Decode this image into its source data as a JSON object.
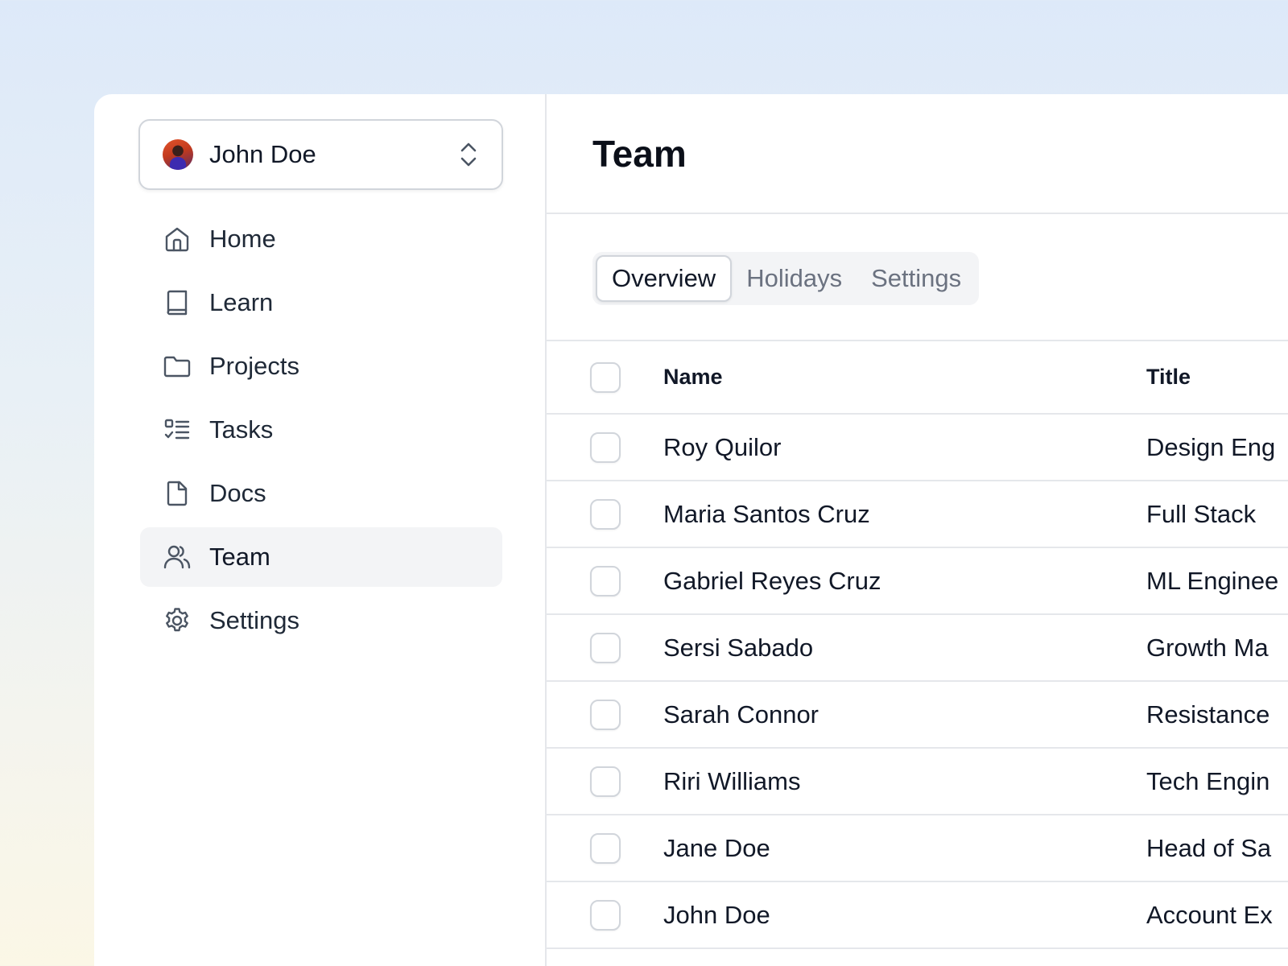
{
  "account": {
    "name": "John Doe",
    "avatar_icon": "user-avatar-photo",
    "switcher_icon": "chevron-up-down-icon"
  },
  "sidebar": {
    "items": [
      {
        "label": "Home",
        "icon": "home-icon",
        "active": false
      },
      {
        "label": "Learn",
        "icon": "book-icon",
        "active": false
      },
      {
        "label": "Projects",
        "icon": "folder-icon",
        "active": false
      },
      {
        "label": "Tasks",
        "icon": "checklist-icon",
        "active": false
      },
      {
        "label": "Docs",
        "icon": "document-icon",
        "active": false
      },
      {
        "label": "Team",
        "icon": "users-icon",
        "active": true
      },
      {
        "label": "Settings",
        "icon": "gear-icon",
        "active": false
      }
    ]
  },
  "page": {
    "title": "Team"
  },
  "tabs": [
    {
      "label": "Overview",
      "active": true
    },
    {
      "label": "Holidays",
      "active": false
    },
    {
      "label": "Settings",
      "active": false
    }
  ],
  "table": {
    "columns": {
      "name": "Name",
      "title": "Title"
    },
    "rows": [
      {
        "name": "Roy Quilor",
        "title": "Design Eng"
      },
      {
        "name": "Maria Santos Cruz",
        "title": "Full Stack"
      },
      {
        "name": "Gabriel Reyes Cruz",
        "title": "ML Enginee"
      },
      {
        "name": "Sersi Sabado",
        "title": "Growth Ma"
      },
      {
        "name": "Sarah Connor",
        "title": "Resistance"
      },
      {
        "name": "Riri Williams",
        "title": "Tech Engin"
      },
      {
        "name": "Jane Doe",
        "title": "Head of Sa"
      },
      {
        "name": "John Doe",
        "title": "Account Ex"
      }
    ]
  },
  "colors": {
    "text_primary": "#111827",
    "text_muted": "#6b7280",
    "border": "#e5e7eb",
    "active_bg": "#f3f4f6",
    "icon_stroke": "#4b5563"
  }
}
